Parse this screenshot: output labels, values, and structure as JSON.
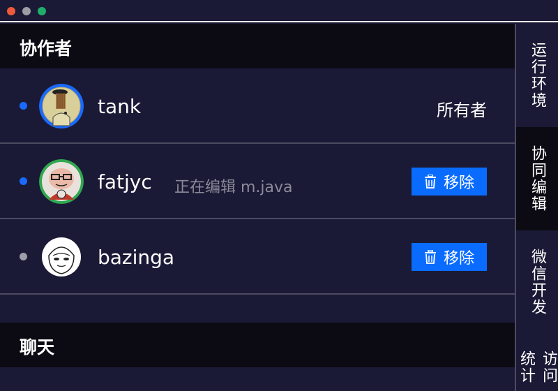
{
  "window": {
    "controls": [
      "close",
      "minimize",
      "maximize"
    ]
  },
  "collaborators": {
    "title": "协作者",
    "members": [
      {
        "name": "tank",
        "online": true,
        "role": "所有者",
        "editing": "",
        "action": ""
      },
      {
        "name": "fatjyc",
        "online": true,
        "role": "",
        "editing": "正在编辑 m.java",
        "action": "移除"
      },
      {
        "name": "bazinga",
        "online": false,
        "role": "",
        "editing": "",
        "action": "移除"
      }
    ]
  },
  "chat": {
    "title": "聊天"
  },
  "side_tabs": [
    {
      "label": "运行环境",
      "active": false
    },
    {
      "label": "协同编辑",
      "active": true
    },
    {
      "label": "微信开发",
      "active": false
    },
    {
      "label": "访问统计",
      "active": false
    }
  ],
  "colors": {
    "background": "#1b1a36",
    "header": "#0c0b14",
    "accent": "#0a6cff",
    "online": "#1a6aff",
    "offline": "#9e9daa",
    "muted_text": "#8a8a99"
  }
}
